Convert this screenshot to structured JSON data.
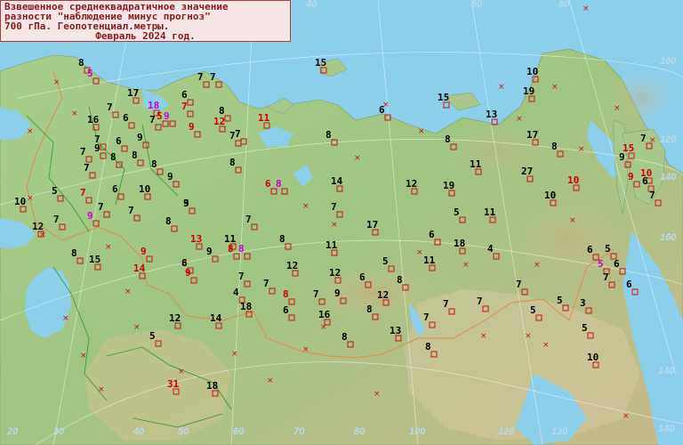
{
  "title": {
    "line1": "Взвешенное среднеквадратичное значение",
    "line2": "разности \"наблюдение минус прогноз\"",
    "line3": "700 гПа. Геопотенциал.метры.",
    "line4": "Февраль 2024 год."
  },
  "grid_labels": [
    {
      "text": "40"
    },
    {
      "text": "60"
    },
    {
      "text": "80"
    },
    {
      "text": "100"
    },
    {
      "text": "120"
    },
    {
      "text": "140"
    },
    {
      "text": "160"
    },
    {
      "text": "140"
    },
    {
      "text": "140"
    },
    {
      "text": "20"
    },
    {
      "text": "30"
    },
    {
      "text": "40"
    },
    {
      "text": "50"
    },
    {
      "text": "60"
    },
    {
      "text": "70"
    },
    {
      "text": "80"
    },
    {
      "text": "100"
    },
    {
      "text": "120"
    },
    {
      "text": "130"
    }
  ],
  "stations": [
    {
      "v": "8",
      "c": "#000000"
    },
    {
      "v": "5",
      "c": "#cc00cc"
    },
    {
      "v": "17",
      "c": "#000000"
    },
    {
      "v": "18",
      "c": "#cc00cc"
    },
    {
      "v": "5",
      "c": "#cc0000"
    },
    {
      "v": "9",
      "c": "#cc00cc"
    },
    {
      "v": "6",
      "c": "#000000"
    },
    {
      "v": "7",
      "c": "#000000"
    },
    {
      "v": "7",
      "c": "#000000"
    },
    {
      "v": "7",
      "c": "#cc0000"
    },
    {
      "v": "9",
      "c": "#cc0000"
    },
    {
      "v": "8",
      "c": "#000000"
    },
    {
      "v": "12",
      "c": "#cc0000"
    },
    {
      "v": "11",
      "c": "#cc0000"
    },
    {
      "v": "15",
      "c": "#000000"
    },
    {
      "v": "7",
      "c": "#000000"
    },
    {
      "v": "16",
      "c": "#000000"
    },
    {
      "v": "6",
      "c": "#000000"
    },
    {
      "v": "7",
      "c": "#000000"
    },
    {
      "v": "6",
      "c": "#000000"
    },
    {
      "v": "9",
      "c": "#000000"
    },
    {
      "v": "7",
      "c": "#000000"
    },
    {
      "v": "9",
      "c": "#000000"
    },
    {
      "v": "8",
      "c": "#000000"
    },
    {
      "v": "7",
      "c": "#000000"
    },
    {
      "v": "7",
      "c": "#000000"
    },
    {
      "v": "8",
      "c": "#000000"
    },
    {
      "v": "8",
      "c": "#000000"
    },
    {
      "v": "7",
      "c": "#000000"
    },
    {
      "v": "8",
      "c": "#000000"
    },
    {
      "v": "7",
      "c": "#000000"
    },
    {
      "v": "9",
      "c": "#000000"
    },
    {
      "v": "5",
      "c": "#000000"
    },
    {
      "v": "7",
      "c": "#cc0000"
    },
    {
      "v": "6",
      "c": "#000000"
    },
    {
      "v": "10",
      "c": "#000000"
    },
    {
      "v": "8",
      "c": "#000000"
    },
    {
      "v": "9",
      "c": "#000000"
    },
    {
      "v": "6",
      "c": "#cc0000"
    },
    {
      "v": "8",
      "c": "#cc00cc"
    },
    {
      "v": "10",
      "c": "#000000"
    },
    {
      "v": "7",
      "c": "#000000"
    },
    {
      "v": "9",
      "c": "#cc00cc"
    },
    {
      "v": "7",
      "c": "#000000"
    },
    {
      "v": "7",
      "c": "#000000"
    },
    {
      "v": "5",
      "c": "#000000"
    },
    {
      "v": "12",
      "c": "#000000"
    },
    {
      "v": "7",
      "c": "#000000"
    },
    {
      "v": "8",
      "c": "#000000"
    },
    {
      "v": "13",
      "c": "#cc0000"
    },
    {
      "v": "11",
      "c": "#000000"
    },
    {
      "v": "8",
      "c": "#cc0000"
    },
    {
      "v": "8",
      "c": "#cc00cc"
    },
    {
      "v": "9",
      "c": "#000000"
    },
    {
      "v": "8",
      "c": "#000000"
    },
    {
      "v": "9",
      "c": "#cc0000"
    },
    {
      "v": "14",
      "c": "#cc0000"
    },
    {
      "v": "8",
      "c": "#cc0000"
    },
    {
      "v": "15",
      "c": "#000000"
    },
    {
      "v": "7",
      "c": "#000000"
    },
    {
      "v": "6",
      "c": "#000000"
    },
    {
      "v": "9",
      "c": "#cc0000"
    },
    {
      "v": "7",
      "c": "#000000"
    },
    {
      "v": "4",
      "c": "#000000"
    },
    {
      "v": "8",
      "c": "#cc0000"
    },
    {
      "v": "7",
      "c": "#000000"
    },
    {
      "v": "18",
      "c": "#000000"
    },
    {
      "v": "6",
      "c": "#000000"
    },
    {
      "v": "12",
      "c": "#000000"
    },
    {
      "v": "14",
      "c": "#000000"
    },
    {
      "v": "5",
      "c": "#000000"
    },
    {
      "v": "31",
      "c": "#cc0000"
    },
    {
      "v": "18",
      "c": "#000000"
    },
    {
      "v": "14",
      "c": "#000000"
    },
    {
      "v": "7",
      "c": "#000000"
    },
    {
      "v": "17",
      "c": "#000000"
    },
    {
      "v": "11",
      "c": "#000000"
    },
    {
      "v": "12",
      "c": "#000000"
    },
    {
      "v": "12",
      "c": "#000000"
    },
    {
      "v": "9",
      "c": "#000000"
    },
    {
      "v": "16",
      "c": "#000000"
    },
    {
      "v": "6",
      "c": "#000000"
    },
    {
      "v": "8",
      "c": "#000000"
    },
    {
      "v": "12",
      "c": "#000000"
    },
    {
      "v": "8",
      "c": "#000000"
    },
    {
      "v": "8",
      "c": "#000000"
    },
    {
      "v": "13",
      "c": "#000000"
    },
    {
      "v": "7",
      "c": "#000000"
    },
    {
      "v": "8",
      "c": "#000000"
    },
    {
      "v": "5",
      "c": "#000000"
    },
    {
      "v": "11",
      "c": "#000000"
    },
    {
      "v": "6",
      "c": "#000000"
    },
    {
      "v": "18",
      "c": "#000000"
    },
    {
      "v": "4",
      "c": "#000000"
    },
    {
      "v": "12",
      "c": "#000000"
    },
    {
      "v": "19",
      "c": "#000000"
    },
    {
      "v": "5",
      "c": "#000000"
    },
    {
      "v": "11",
      "c": "#000000"
    },
    {
      "v": "11",
      "c": "#000000"
    },
    {
      "v": "8",
      "c": "#000000"
    },
    {
      "v": "15",
      "c": "#000000"
    },
    {
      "v": "6",
      "c": "#000000"
    },
    {
      "v": "13",
      "c": "#000000"
    },
    {
      "v": "8",
      "c": "#000000"
    },
    {
      "v": "19",
      "c": "#000000"
    },
    {
      "v": "17",
      "c": "#000000"
    },
    {
      "v": "8",
      "c": "#000000"
    },
    {
      "v": "27",
      "c": "#000000"
    },
    {
      "v": "10",
      "c": "#cc0000"
    },
    {
      "v": "10",
      "c": "#000000"
    },
    {
      "v": "7",
      "c": "#000000"
    },
    {
      "v": "7",
      "c": "#000000"
    },
    {
      "v": "7",
      "c": "#000000"
    },
    {
      "v": "5",
      "c": "#000000"
    },
    {
      "v": "3",
      "c": "#000000"
    },
    {
      "v": "5",
      "c": "#000000"
    },
    {
      "v": "5",
      "c": "#000000"
    },
    {
      "v": "6",
      "c": "#000000"
    },
    {
      "v": "5",
      "c": "#000000"
    },
    {
      "v": "5",
      "c": "#cc00cc"
    },
    {
      "v": "6",
      "c": "#000000"
    },
    {
      "v": "7",
      "c": "#000000"
    },
    {
      "v": "6",
      "c": "#000000"
    },
    {
      "v": "7",
      "c": "#000000"
    },
    {
      "v": "15",
      "c": "#cc0000"
    },
    {
      "v": "9",
      "c": "#000000"
    },
    {
      "v": "10",
      "c": "#cc0000"
    },
    {
      "v": "6",
      "c": "#000000"
    },
    {
      "v": "9",
      "c": "#cc0000"
    },
    {
      "v": "7",
      "c": "#000000"
    },
    {
      "v": "10",
      "c": "#000000"
    },
    {
      "v": "10",
      "c": "#000000"
    },
    {
      "v": "7",
      "c": "#000000"
    }
  ]
}
